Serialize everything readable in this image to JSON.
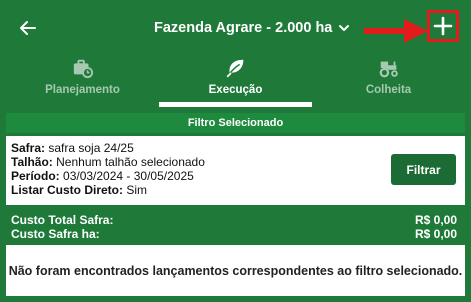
{
  "header": {
    "title": "Fazenda Agrare - 2.000 ha",
    "back_icon": "arrow-left-icon",
    "add_icon": "plus-icon",
    "annotation_color": "#e01c1c"
  },
  "tabs": [
    {
      "label": "Planejamento",
      "icon": "briefcase-clock-icon",
      "active": false
    },
    {
      "label": "Execução",
      "icon": "leaf-icon",
      "active": true
    },
    {
      "label": "Colheita",
      "icon": "tractor-icon",
      "active": false
    }
  ],
  "filter": {
    "heading": "Filtro Selecionado",
    "safra_label": "Safra:",
    "safra_value": "safra soja 24/25",
    "talhao_label": "Talhão:",
    "talhao_value": "Nenhum talhão selecionado",
    "periodo_label": "Período:",
    "periodo_value": "03/03/2024 - 30/05/2025",
    "custo_label": "Listar Custo Direto:",
    "custo_value": "Sim",
    "button_label": "Filtrar"
  },
  "totals": {
    "total_label": "Custo Total Safra:",
    "total_value": "R$ 0,00",
    "ha_label": "Custo Safra ha:",
    "ha_value": "R$ 0,00"
  },
  "message": "Não foram encontrados lançamentos correspondentes ao filtro selecionado.",
  "colors": {
    "primary": "#1f7a3a",
    "button": "#1c6b35",
    "accent_red": "#e01c1c"
  }
}
